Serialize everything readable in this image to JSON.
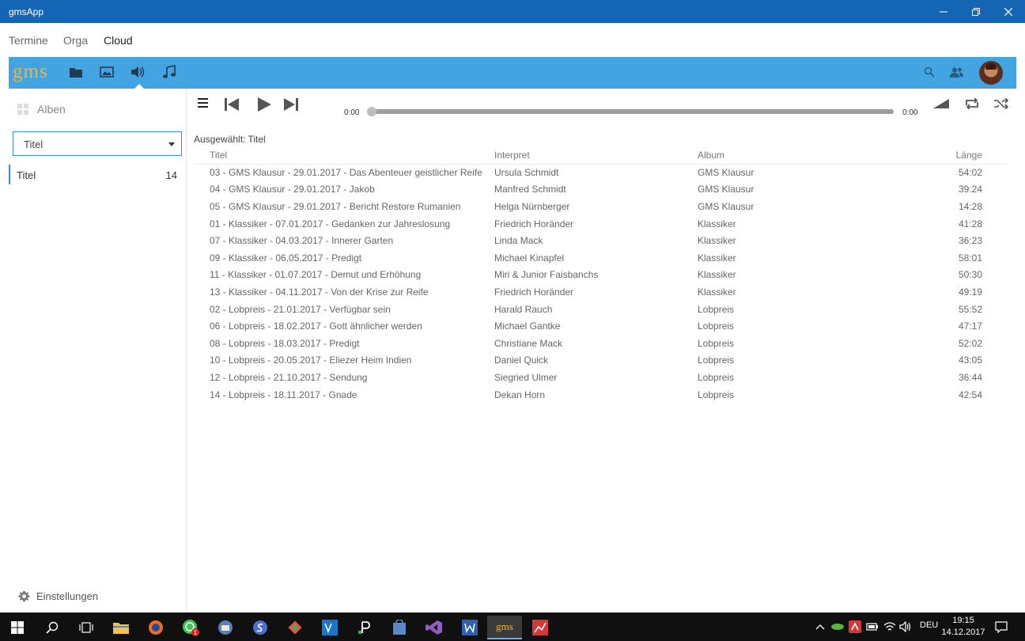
{
  "window": {
    "title": "gmsApp"
  },
  "menu": {
    "items": [
      "Termine",
      "Orga",
      "Cloud"
    ],
    "active": "Cloud"
  },
  "appbar": {
    "logo": "gms"
  },
  "sidebar": {
    "albums_label": "Alben",
    "select_value": "Titel",
    "category": {
      "label": "Titel",
      "count": "14"
    },
    "settings_label": "Einstellungen"
  },
  "player": {
    "current_time": "0:00",
    "total_time": "0:00",
    "progress": 0
  },
  "content": {
    "selected_label": "Ausgewählt: Titel",
    "columns": [
      "Titel",
      "Interpret",
      "Album",
      "Länge"
    ],
    "rows": [
      [
        "03 - GMS Klausur - 29.01.2017 - Das Abenteuer geistlicher Reife",
        "Ursula Schmidt",
        "GMS Klausur",
        "54:02"
      ],
      [
        "04 - GMS Klausur - 29.01.2017 - Jakob",
        "Manfred Schmidt",
        "GMS Klausur",
        "39:24"
      ],
      [
        "05 - GMS Klausur - 29.01.2017 - Bericht Restore Rumanien",
        "Helga Nürnberger",
        "GMS Klausur",
        "14:28"
      ],
      [
        "01 - Klassiker - 07.01.2017 - Gedanken zur Jahreslosung",
        "Friedrich Horänder",
        "Klassiker",
        "41:28"
      ],
      [
        "07 - Klassiker - 04.03.2017 - Innerer Garten",
        "Linda Mack",
        "Klassiker",
        "36:23"
      ],
      [
        "09 - Klassiker - 06.05.2017 - Predigt",
        "Michael Kinapfel",
        "Klassiker",
        "58:01"
      ],
      [
        "11 - Klassiker - 01.07.2017 - Demut und Erhöhung",
        "Miri & Junior Faisbanchs",
        "Klassiker",
        "50:30"
      ],
      [
        "13 - Klassiker - 04.11.2017 - Von der Krise zur Reife",
        "Friedrich Horänder",
        "Klassiker",
        "49:19"
      ],
      [
        "02 - Lobpreis - 21.01.2017 - Verfügbar sein",
        "Harald Rauch",
        "Lobpreis",
        "55:52"
      ],
      [
        "06 - Lobpreis - 18.02.2017 - Gott ähnlicher werden",
        "Michael Gantke",
        "Lobpreis",
        "47:17"
      ],
      [
        "08 - Lobpreis - 18.03.2017 - Predigt",
        "Christiane Mack",
        "Lobpreis",
        "52:02"
      ],
      [
        "10 - Lobpreis - 20.05.2017 - Eliezer Heim Indien",
        "Daniel Quick",
        "Lobpreis",
        "43:05"
      ],
      [
        "12 - Lobpreis - 21.10.2017 - Sendung",
        "Siegried Ulmer",
        "Lobpreis",
        "36:44"
      ],
      [
        "14 - Lobpreis - 18.11.2017 - Gnade",
        "Dekan Horn",
        "Lobpreis",
        "42:54"
      ]
    ]
  },
  "taskbar": {
    "gms_label": "gms",
    "whatsapp_badge": "1",
    "language": "DEU",
    "time": "19:15",
    "date": "14.12.2017"
  }
}
